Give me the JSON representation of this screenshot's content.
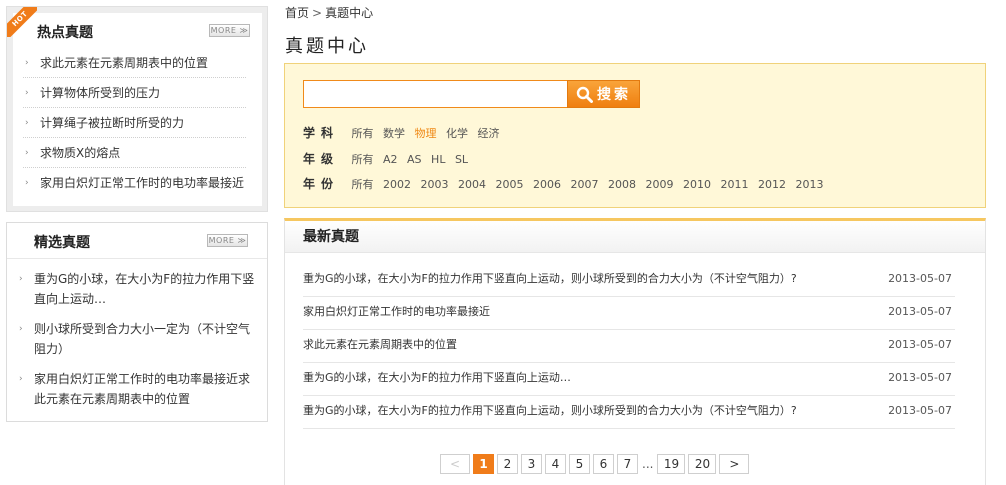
{
  "hot": {
    "badge": "HOT",
    "title": "热点真题",
    "more": "MORE ≫",
    "items": [
      "求此元素在元素周期表中的位置",
      "计算物体所受到的压力",
      "计算绳子被拉断时所受的力",
      "求物质X的熔点",
      "家用白炽灯正常工作时的电功率最接近"
    ]
  },
  "picked": {
    "title": "精选真题",
    "more": "MORE ≫",
    "items": [
      "重为G的小球，在大小为F的拉力作用下竖直向上运动…",
      "则小球所受到合力大小一定为（不计空气阻力）",
      "家用白炽灯正常工作时的电功率最接近求此元素在元素周期表中的位置"
    ]
  },
  "breadcrumb": {
    "home": "首页",
    "sep": ">",
    "current": "真题中心"
  },
  "page_title": "真题中心",
  "search": {
    "value": "",
    "placeholder": "",
    "button": "搜索"
  },
  "filters": [
    {
      "label": "学科",
      "options": [
        "所有",
        "数学",
        "物理",
        "化学",
        "经济"
      ],
      "active": 2
    },
    {
      "label": "年级",
      "options": [
        "所有",
        "A2",
        "AS",
        "HL",
        "SL"
      ],
      "active": -1
    },
    {
      "label": "年份",
      "options": [
        "所有",
        "2002",
        "2003",
        "2004",
        "2005",
        "2006",
        "2007",
        "2008",
        "2009",
        "2010",
        "2011",
        "2012",
        "2013"
      ],
      "active": -1
    }
  ],
  "latest": {
    "title": "最新真题",
    "items": [
      {
        "text": "重为G的小球，在大小为F的拉力作用下竖直向上运动，则小球所受到的合力大小为（不计空气阻力）?",
        "date": "2013-05-07"
      },
      {
        "text": "家用白炽灯正常工作时的电功率最接近",
        "date": "2013-05-07"
      },
      {
        "text": "求此元素在元素周期表中的位置",
        "date": "2013-05-07"
      },
      {
        "text": "重为G的小球，在大小为F的拉力作用下竖直向上运动…",
        "date": "2013-05-07"
      },
      {
        "text": "重为G的小球，在大小为F的拉力作用下竖直向上运动，则小球所受到的合力大小为（不计空气阻力）?",
        "date": "2013-05-07"
      }
    ]
  },
  "pager": {
    "prev": "<",
    "pages": [
      "1",
      "2",
      "3",
      "4",
      "5",
      "6",
      "7"
    ],
    "ellipsis": "...",
    "tail": [
      "19",
      "20"
    ],
    "next": ">",
    "current": "1"
  },
  "colors": {
    "accent": "#f07c1a",
    "panel_bg": "#fff8d8",
    "panel_border": "#f0d27a"
  },
  "icons": {
    "search": "search-icon",
    "bullet": "arrow-bullet-icon"
  }
}
